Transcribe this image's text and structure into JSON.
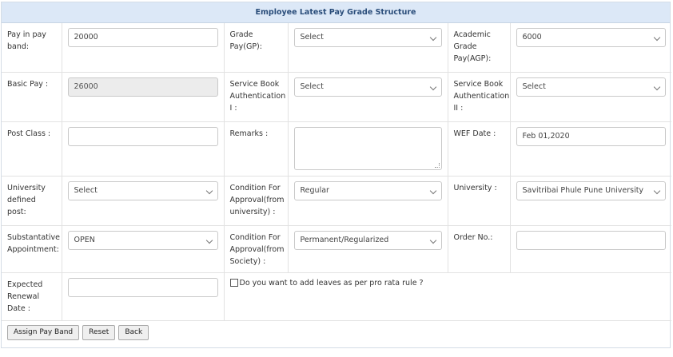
{
  "header": {
    "title": "Employee Latest Pay Grade Structure"
  },
  "row1": {
    "pay_in_pay_band_label": "Pay in pay band:",
    "pay_in_pay_band_value": "20000",
    "grade_pay_label": "Grade Pay(GP):",
    "grade_pay_value": "Select",
    "agp_label": "Academic Grade Pay(AGP):",
    "agp_value": "6000"
  },
  "row2": {
    "basic_pay_label": "Basic Pay :",
    "basic_pay_value": "26000",
    "sb_auth_1_label": "Service Book Authentication I :",
    "sb_auth_1_value": "Select",
    "sb_auth_2_label": "Service Book Authentication II :",
    "sb_auth_2_value": "Select"
  },
  "row3": {
    "post_class_label": "Post Class :",
    "post_class_value": "",
    "remarks_label": "Remarks :",
    "remarks_value": "",
    "wef_date_label": "WEF Date :",
    "wef_date_value": "Feb 01,2020"
  },
  "row4": {
    "univ_post_label": "University defined post:",
    "univ_post_value": "Select",
    "cond_univ_label": "Condition For Approval(from university) :",
    "cond_univ_value": "Regular",
    "university_label": "University :",
    "university_value": "Savitribai Phule Pune University"
  },
  "row5": {
    "substantive_label": "Substantative Appointment:",
    "substantive_value": "OPEN",
    "cond_society_label": "Condition For Approval(from Society) :",
    "cond_society_value": "Permanent/Regularized",
    "order_no_label": "Order No.:",
    "order_no_value": ""
  },
  "row6": {
    "renewal_label": "Expected Renewal Date :",
    "renewal_value": "",
    "leaves_label": "Do you want to add leaves as per pro rata rule ?",
    "leaves_checked": false
  },
  "buttons": {
    "assign": "Assign Pay Band",
    "reset": "Reset",
    "back": "Back"
  }
}
